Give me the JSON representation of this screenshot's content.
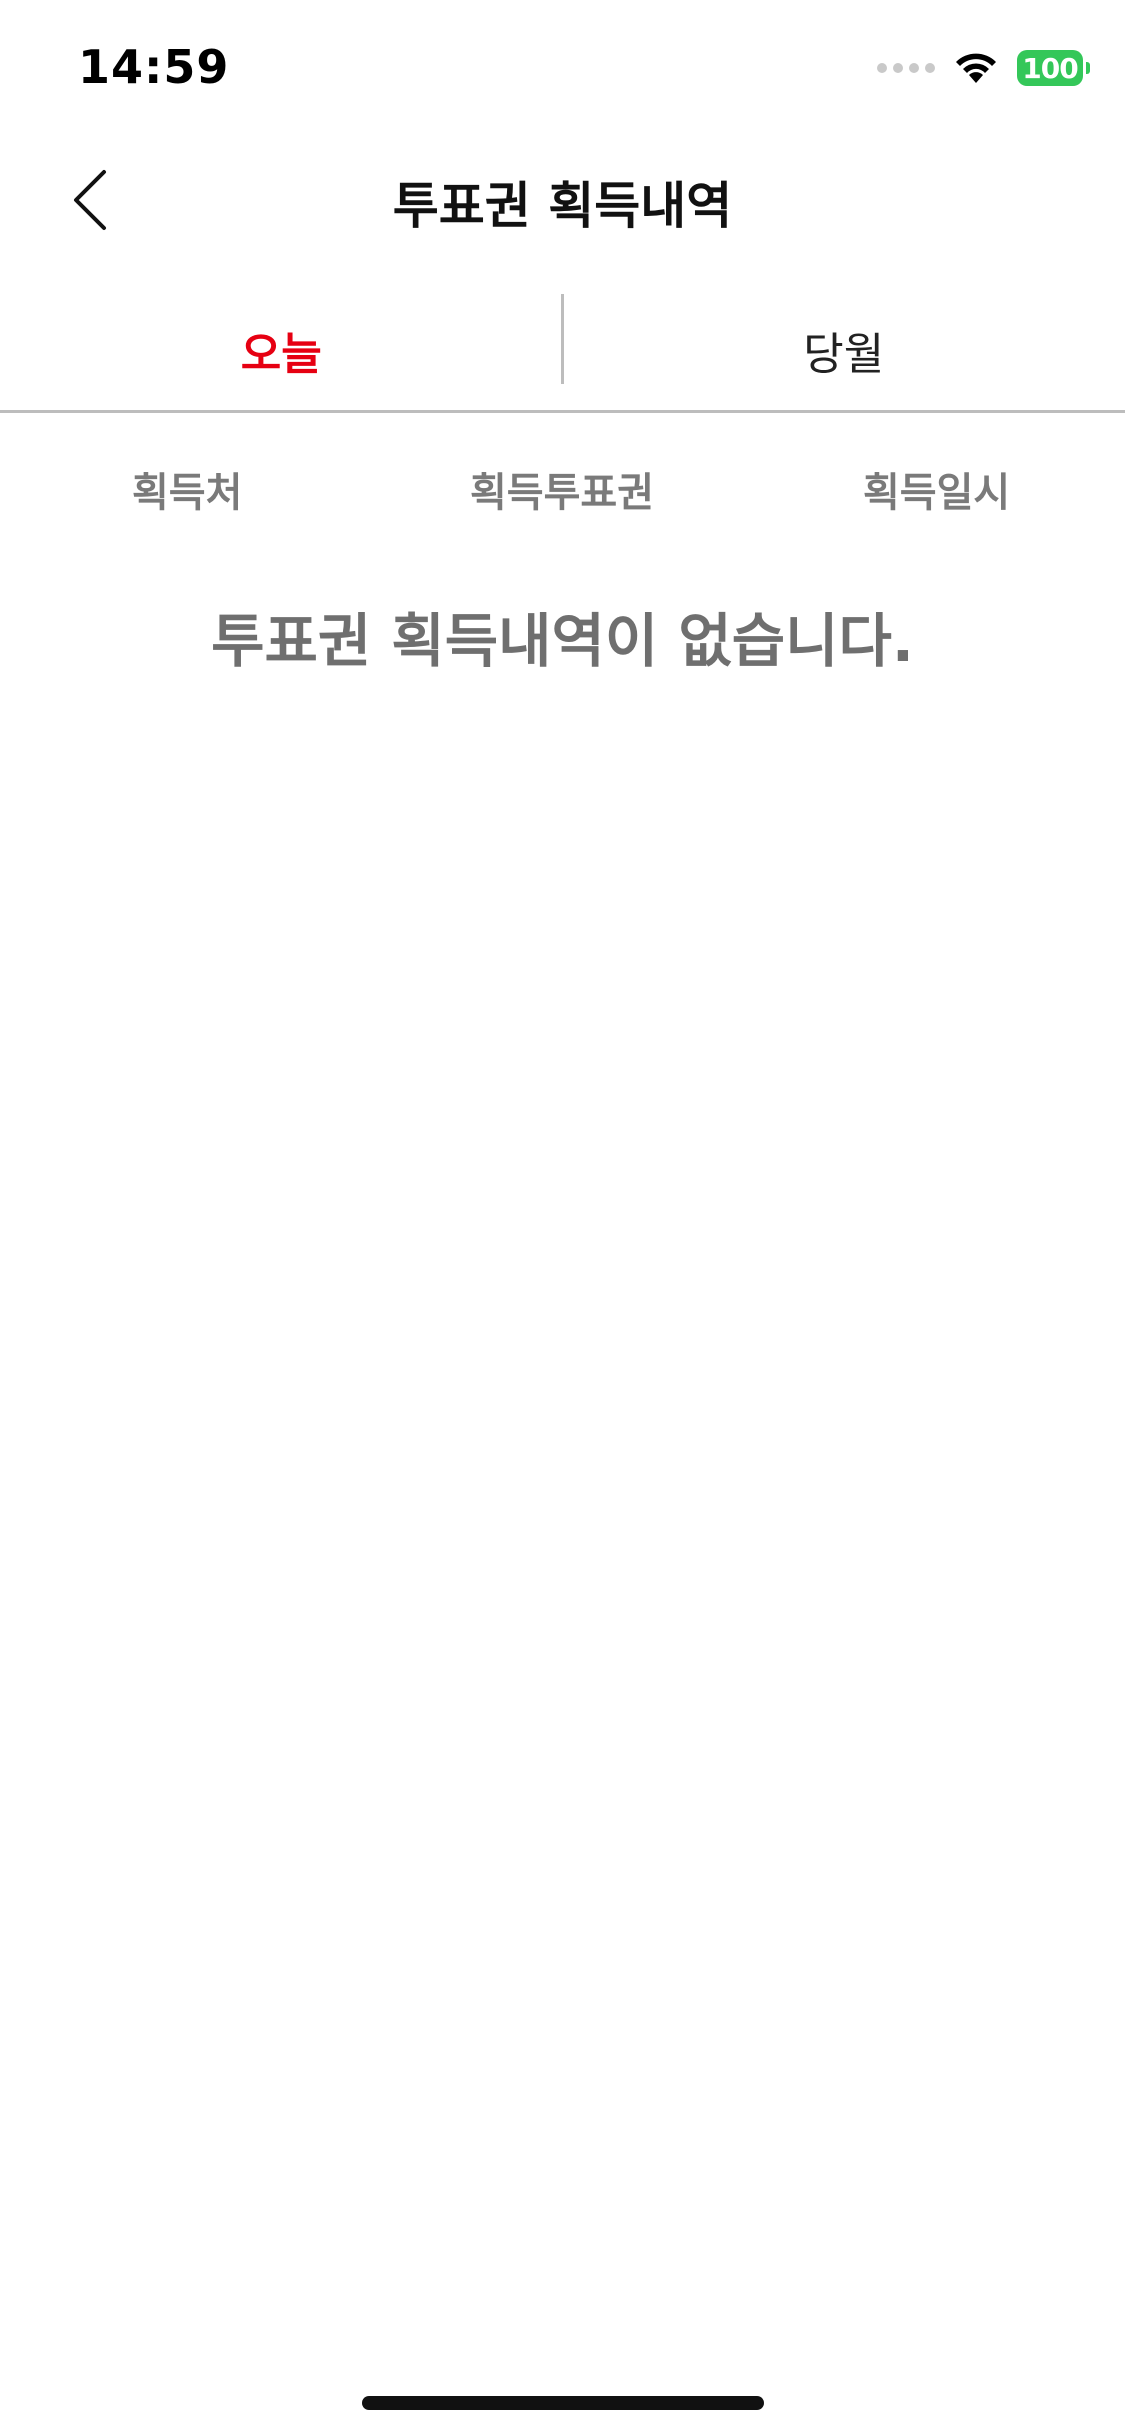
{
  "status_bar": {
    "time": "14:59",
    "battery": "100",
    "signal_icon": "cellular-dots-icon",
    "wifi_icon": "wifi-icon"
  },
  "header": {
    "title": "투표권 획득내역",
    "back_icon": "chevron-left-icon"
  },
  "tabs": [
    {
      "label": "오늘",
      "active": true
    },
    {
      "label": "당월",
      "active": false
    }
  ],
  "columns": {
    "source": "획득처",
    "tickets": "획득투표권",
    "date": "획득일시"
  },
  "empty_message": "투표권 획득내역이 없습니다.",
  "colors": {
    "accent": "#e60012",
    "battery": "#34c759",
    "muted_text": "#7a7a7a",
    "divider": "#bdbdbd"
  }
}
